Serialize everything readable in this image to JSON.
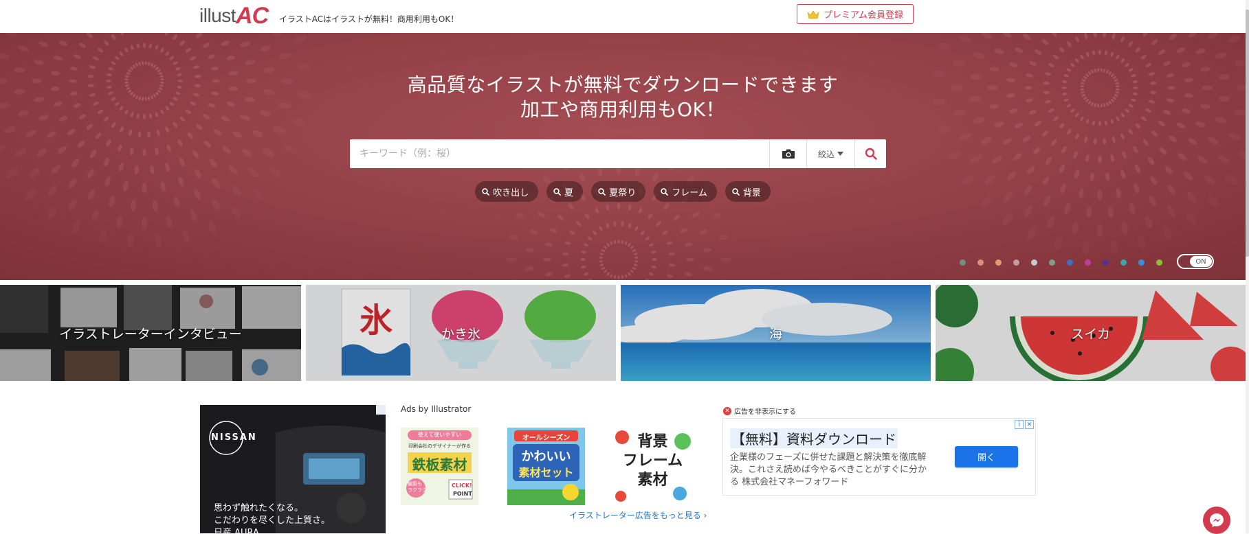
{
  "header": {
    "logo_illust": "illust",
    "logo_ac": "AC",
    "tagline": "イラストACはイラストが無料！商用利用もOK！",
    "premium_label": "プレミアム会員登録"
  },
  "hero": {
    "title_line1": "高品質なイラストが無料でダウンロードできます",
    "title_line2": "加工や商用利用もOK！",
    "search_placeholder": "キーワード（例：桜）",
    "filter_label": "絞込",
    "tags": [
      "吹き出し",
      "夏",
      "夏祭り",
      "フレーム",
      "背景"
    ],
    "dot_colors": [
      "#6f8f84",
      "#e08b7f",
      "#e39b6f",
      "#c79aa0",
      "#c8c8d0",
      "#7f9f8a",
      "#3d6fc9",
      "#c43a9a",
      "#5b2f8f",
      "#3aa6a6",
      "#3a8fd9",
      "#8fbf3a"
    ],
    "toggle_label": "ON"
  },
  "tiles": [
    {
      "label": "イラストレーターインタビュー"
    },
    {
      "label": "かき氷"
    },
    {
      "label": "海"
    },
    {
      "label": "スイカ"
    }
  ],
  "ads": {
    "nissan_brand": "NISSAN",
    "nissan_copy1": "思わず触れたくなる。",
    "nissan_copy2": "こだわりを尽くした上質さ。",
    "nissan_copy3": "日産 AURA",
    "ads_by": "Ads by Illustrator",
    "thumb1": "鉄板素材",
    "thumb1_top": "印刷会社のデザイナーが作る",
    "thumb1_badge": "使えて使いやすい",
    "thumb1_small1": "編集も",
    "thumb1_small2": "ラクラク",
    "thumb1_click": "CLICK!",
    "thumb1_point": "POINT",
    "thumb2_top": "オールシーズン",
    "thumb2_line1": "かわいい",
    "thumb2_line2": "素材セット",
    "thumb3_line1": "背景",
    "thumb3_line2": "フレーム",
    "thumb3_line3": "素材",
    "more_link": "イラストレーター広告をもっと見る ›",
    "hide_label": "広告を非表示にする",
    "right_title": "【無料】資料ダウンロード",
    "right_desc": "企業様のフェーズに併せた課題と解決策を徹底解決。これさえ読めば今やるべきことがすぐに分かる 株式会社マネーフォワード",
    "open_label": "開く"
  }
}
